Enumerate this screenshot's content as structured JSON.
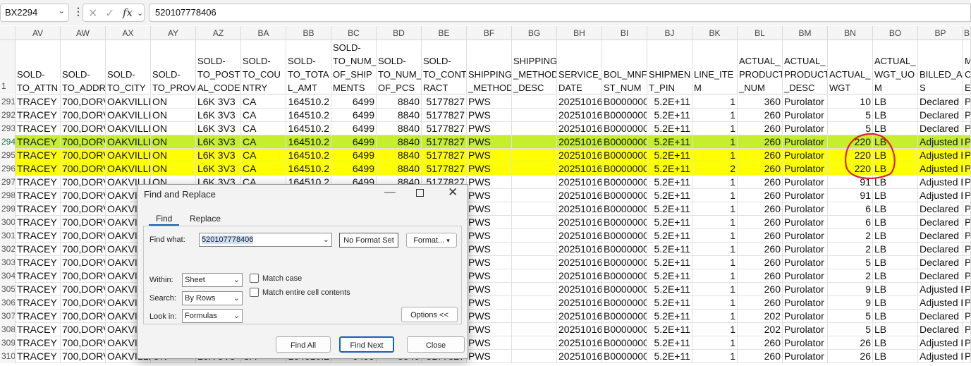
{
  "formula_bar": {
    "name_box": "BX2294",
    "cancel_glyph": "✕",
    "enter_glyph": "✓",
    "fx_glyph": "fx",
    "value": "520107778406"
  },
  "columns": [
    "AV",
    "AW",
    "AX",
    "AY",
    "AZ",
    "BA",
    "BB",
    "BC",
    "BD",
    "BE",
    "BF",
    "BG",
    "BH",
    "BI",
    "BJ",
    "BK",
    "BL",
    "BM",
    "BN",
    "BO",
    "BP",
    "B"
  ],
  "header_row": {
    "row_num": "1",
    "cells": [
      "SOLD-\nTO_ATTN",
      "SOLD-\nTO_ADDR",
      "SOLD-\nTO_CITY",
      "SOLD-\nTO_PROV",
      "SOLD-\nTO_POST\nAL_CODE",
      "SOLD-\nTO_COU\nNTRY",
      "SOLD-\nTO_TOTA\nL_AMT",
      "SOLD-\nTO_NUM_\nOF_SHIP\nMENTS",
      "SOLD-\nTO_NUM_\nOF_PCS",
      "SOLD-\nTO_CONT\nRACT",
      "SHIPPING\n_METHOD",
      "SHIPPING\n_METHOD\n_DESC",
      "SERVICE_\nDATE",
      "BOL_MNF\nST_NUM",
      "SHIPMEN\nT_PIN",
      "LINE_ITE\nM",
      "ACTUAL_\nPRODUCT\n_NUM",
      "ACTUAL_\nPRODUCT\n_DESC",
      "ACTUAL_\nWGT",
      "ACTUAL_\nWGT_UO\nM",
      "BILLED_A\nS",
      "M\nC\nE"
    ]
  },
  "rows": [
    {
      "n": "291",
      "wgt": "10",
      "bn": "360",
      "line": "1",
      "billed": "Declared E",
      "hl": ""
    },
    {
      "n": "292",
      "wgt": "5",
      "bn": "260",
      "line": "1",
      "billed": "Declared E",
      "hl": ""
    },
    {
      "n": "293",
      "wgt": "5",
      "bn": "260",
      "line": "1",
      "billed": "Declared E",
      "hl": ""
    },
    {
      "n": "294",
      "wgt": "220",
      "bn": "260",
      "line": "1",
      "billed": "Adjusted E",
      "hl": "green"
    },
    {
      "n": "295",
      "wgt": "220",
      "bn": "260",
      "line": "1",
      "billed": "Adjusted E",
      "hl": "yellow"
    },
    {
      "n": "296",
      "wgt": "220",
      "bn": "260",
      "line": "2",
      "billed": "Adjusted E",
      "hl": "yellow"
    },
    {
      "n": "297",
      "wgt": "91",
      "bn": "260",
      "line": "1",
      "billed": "Adjusted E",
      "hl": ""
    },
    {
      "n": "298",
      "wgt": "91",
      "bn": "260",
      "line": "1",
      "billed": "Adjusted E",
      "hl": ""
    },
    {
      "n": "299",
      "wgt": "6",
      "bn": "260",
      "line": "1",
      "billed": "Declared E",
      "hl": ""
    },
    {
      "n": "300",
      "wgt": "6",
      "bn": "260",
      "line": "1",
      "billed": "Declared E",
      "hl": ""
    },
    {
      "n": "301",
      "wgt": "2",
      "bn": "260",
      "line": "1",
      "billed": "Declared E",
      "hl": ""
    },
    {
      "n": "302",
      "wgt": "2",
      "bn": "260",
      "line": "1",
      "billed": "Declared E",
      "hl": ""
    },
    {
      "n": "303",
      "wgt": "5",
      "bn": "260",
      "line": "1",
      "billed": "Declared E",
      "hl": ""
    },
    {
      "n": "304",
      "wgt": "2",
      "bn": "260",
      "line": "1",
      "billed": "Declared E",
      "hl": ""
    },
    {
      "n": "305",
      "wgt": "9",
      "bn": "260",
      "line": "1",
      "billed": "Adjusted E",
      "hl": ""
    },
    {
      "n": "306",
      "wgt": "9",
      "bn": "260",
      "line": "1",
      "billed": "Adjusted E",
      "hl": ""
    },
    {
      "n": "307",
      "wgt": "5",
      "bn": "202",
      "line": "1",
      "billed": "Declared E",
      "hl": ""
    },
    {
      "n": "308",
      "wgt": "5",
      "bn": "202",
      "line": "1",
      "billed": "Declared E",
      "hl": ""
    },
    {
      "n": "309",
      "wgt": "26",
      "bn": "260",
      "line": "1",
      "billed": "Adjusted E",
      "hl": ""
    },
    {
      "n": "310",
      "wgt": "26",
      "bn": "260",
      "line": "1",
      "billed": "Adjusted E",
      "hl": ""
    }
  ],
  "common": {
    "attn": "TRACEY N/",
    "addr": "700,DORV",
    "city": "OAKVILLE",
    "prov": "ON",
    "postal": "L6K 3V3",
    "country": "CA",
    "total": "164510.2",
    "ships": "6499",
    "pcs": "8840",
    "contract": "5177827",
    "method": "PWS",
    "method_desc": "",
    "date": "20251016",
    "bol": "B00000000",
    "pin": "5.2E+11",
    "prod_desc": "Purolator",
    "uom": "LB",
    "last": "P"
  },
  "dialog": {
    "title": "Find and Replace",
    "tab_find": "Find",
    "tab_replace": "Replace",
    "find_what_label": "Find what:",
    "find_what_value": "520107778406",
    "no_format": "No Format Set",
    "format_btn": "Format...",
    "within_label": "Within:",
    "within_value": "Sheet",
    "search_label": "Search:",
    "search_value": "By Rows",
    "lookin_label": "Look in:",
    "lookin_value": "Formulas",
    "match_case": "Match case",
    "match_entire": "Match entire cell contents",
    "options_btn": "Options <<",
    "find_all": "Find All",
    "find_next": "Find Next",
    "close": "Close"
  },
  "colors": {
    "green_highlight": "#c6ee2d",
    "yellow_highlight": "#ffff00",
    "annotation": "#e0202a",
    "accent": "#1a5fb4"
  }
}
